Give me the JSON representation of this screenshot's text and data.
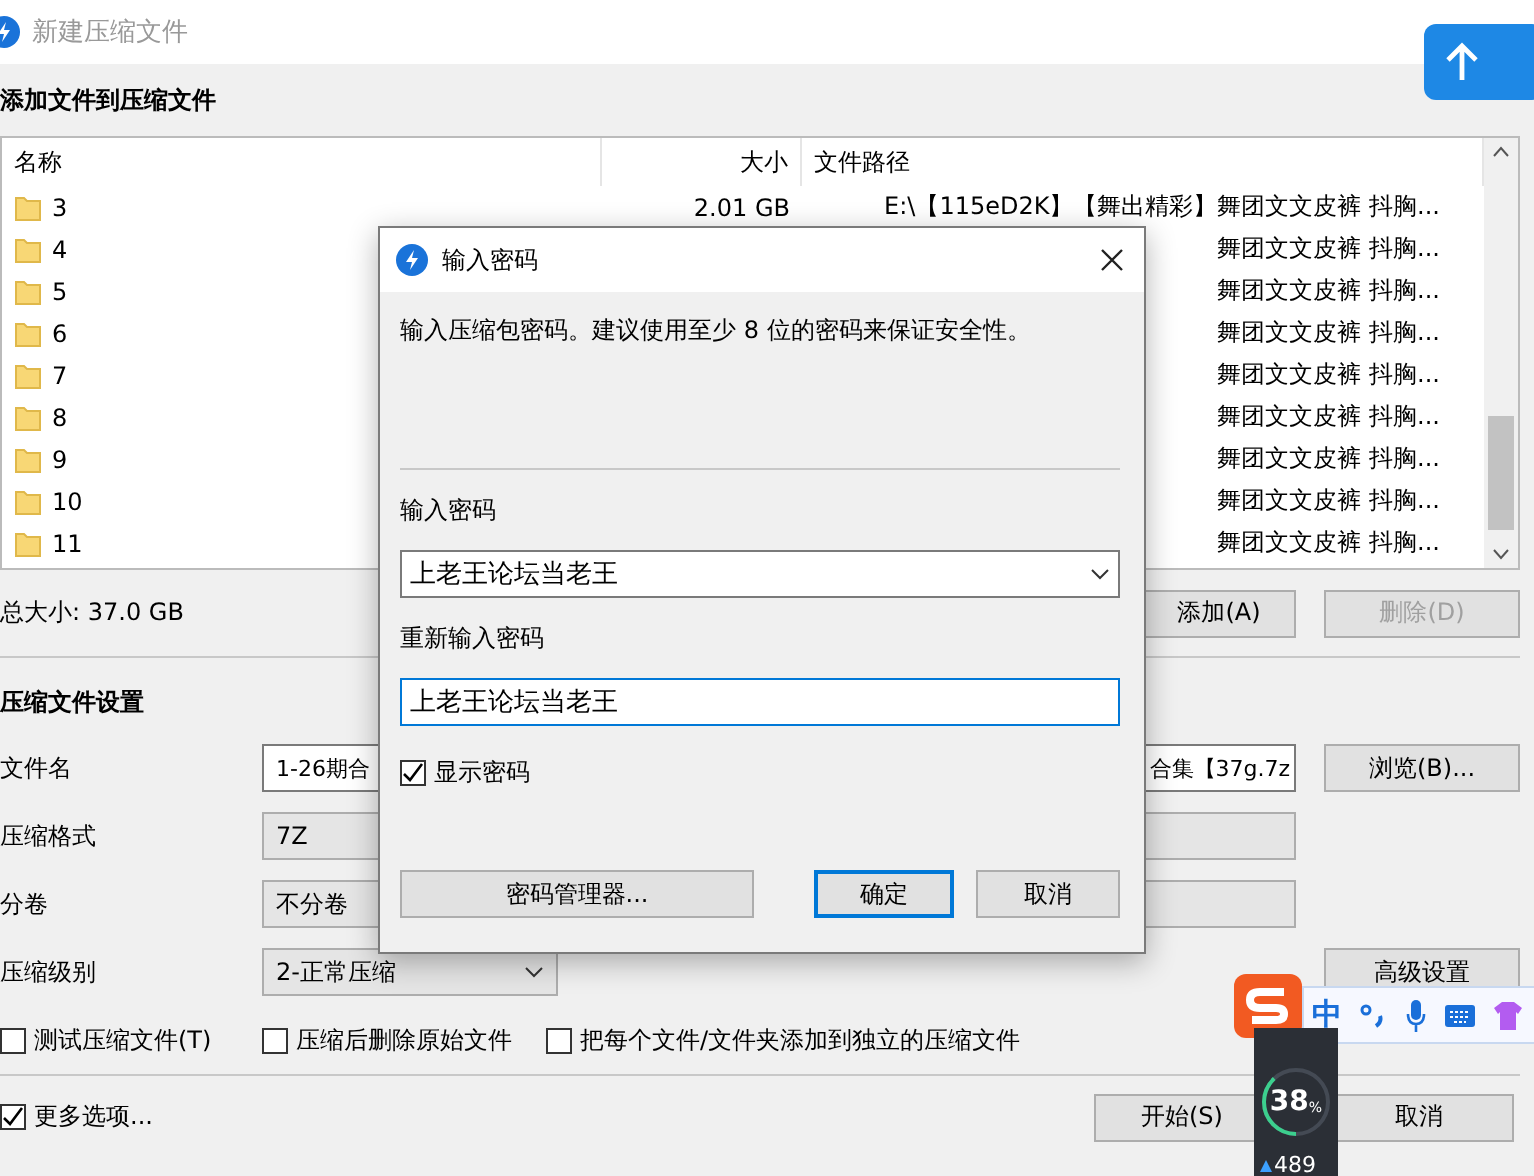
{
  "window": {
    "title": "新建压缩文件"
  },
  "files": {
    "title": "添加文件到压缩文件",
    "columns": [
      "名称",
      "大小",
      "文件路径"
    ],
    "rows": [
      {
        "name": "3",
        "size": "2.01 GB",
        "path": "E:\\【115eD2K】【舞出精彩】舞团文文皮裤 抖胸..."
      },
      {
        "name": "4",
        "path": "舞团文文皮裤 抖胸..."
      },
      {
        "name": "5",
        "path": "舞团文文皮裤 抖胸..."
      },
      {
        "name": "6",
        "path": "舞团文文皮裤 抖胸..."
      },
      {
        "name": "7",
        "path": "舞团文文皮裤 抖胸..."
      },
      {
        "name": "8",
        "path": "舞团文文皮裤 抖胸..."
      },
      {
        "name": "9",
        "path": "舞团文文皮裤 抖胸..."
      },
      {
        "name": "10",
        "path": "舞团文文皮裤 抖胸..."
      },
      {
        "name": "11",
        "path": "舞团文文皮裤 抖胸..."
      }
    ],
    "total": "总大小: 37.0 GB",
    "buttons": [
      {
        "label": "添加(A)",
        "disabled": false
      },
      {
        "label": "删除(D)",
        "disabled": true
      }
    ]
  },
  "settings": {
    "title": "压缩文件设置",
    "fields": [
      {
        "kind": "text",
        "label": "文件名",
        "value_start": "1-26期合",
        "value_end": "合集【37g.7z",
        "button": "浏览(B)..."
      },
      {
        "kind": "select",
        "label": "压缩格式",
        "value": "7Z"
      },
      {
        "kind": "select",
        "label": "分卷",
        "value": "不分卷"
      },
      {
        "kind": "select",
        "label": "压缩级别",
        "value": "2-正常压缩",
        "button": "高级设置"
      }
    ],
    "options": [
      {
        "label": "测试压缩文件(T)",
        "checked": false
      },
      {
        "label": "压缩后删除原始文件",
        "checked": false
      },
      {
        "label": "把每个文件/文件夹添加到独立的压缩文件",
        "checked": false
      }
    ]
  },
  "more_options": {
    "label": "更多选项...",
    "checked": true
  },
  "footer_buttons": [
    "开始(S)",
    "取消"
  ],
  "dialog": {
    "title": "输入密码",
    "description": "输入压缩包密码。建议使用至少 8 位的密码来保证安全性。",
    "password_label": "输入密码",
    "password": "上老王论坛当老王",
    "confirm_label": "重新输入密码",
    "confirm": "上老王论坛当老王",
    "show_password": {
      "label": "显示密码",
      "checked": true
    },
    "buttons": [
      {
        "label": "密码管理器...",
        "default": false
      },
      {
        "label": "确定",
        "default": true
      },
      {
        "label": "取消",
        "default": false
      }
    ]
  },
  "ime_bar": {
    "mode": "中"
  },
  "monitor": {
    "percent": "38",
    "unit": "%",
    "level": 0.38,
    "count": "489"
  }
}
